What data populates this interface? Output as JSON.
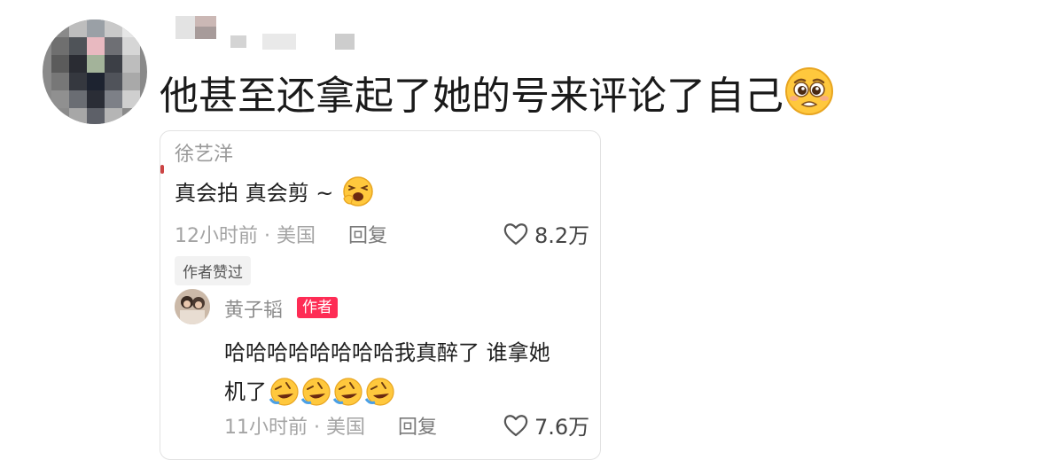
{
  "post": {
    "text": "他甚至还拿起了她的号来评论了自己",
    "emoji": "pleading-face-emoji"
  },
  "comment": {
    "author": "徐艺洋",
    "text": "真会拍 真会剪 ~",
    "time": "12小时前 · 美国",
    "reply_label": "回复",
    "likes": "8.2万",
    "liked_badge": "作者赞过"
  },
  "reply": {
    "author": "黄子韬",
    "author_tag": "作者",
    "text_line1": "哈哈哈哈哈哈哈哈我真醉了 谁拿",
    "text_line1_cut": "她",
    "text_line2": "机了",
    "time": "11小时前 · 美国",
    "reply_label": "回复",
    "likes": "7.6万"
  },
  "colors": {
    "author_tag": "#fe2c55",
    "meta_text": "#a4a4a4",
    "emoji_yellow": "#ffc83d"
  }
}
